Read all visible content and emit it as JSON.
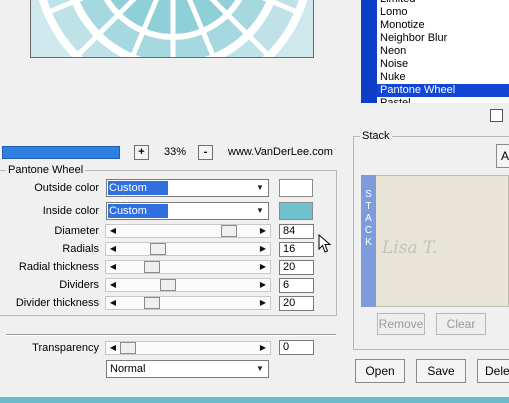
{
  "preview": {
    "accent": "#cfe8ee"
  },
  "zoom": {
    "plus": "+",
    "value": "33%",
    "minus": "-",
    "site": "www.VanDerLee.com"
  },
  "effect_group": {
    "title": "Pantone Wheel",
    "outside_color": {
      "label": "Outside color",
      "value": "Custom >>>",
      "swatch": "#ffffff"
    },
    "inside_color": {
      "label": "Inside color",
      "value": "Custom >>>",
      "swatch": "#6ec1cd"
    },
    "sliders": [
      {
        "label": "Diameter",
        "value": "84",
        "level": 0.84
      },
      {
        "label": "Radials",
        "value": "16",
        "level": 0.25
      },
      {
        "label": "Radial thickness",
        "value": "20",
        "level": 0.2
      },
      {
        "label": "Dividers",
        "value": "6",
        "level": 0.33
      },
      {
        "label": "Divider thickness",
        "value": "20",
        "level": 0.2
      }
    ]
  },
  "transparency": {
    "label": "Transparency",
    "value": "0",
    "level": 0
  },
  "blend_mode": {
    "value": "Normal"
  },
  "effects_list": {
    "items": [
      "Limited",
      "Lomo",
      "Monotize",
      "Neighbor Blur",
      "Neon",
      "Noise",
      "Nuke",
      "Pantone Wheel",
      "Pastel"
    ],
    "selected": "Pantone Wheel"
  },
  "stack": {
    "title": "Stack",
    "add_label": "A",
    "strip_letters": [
      "S",
      "T",
      "A",
      "C",
      "K"
    ],
    "remove_label": "Remove",
    "clear_label": "Clear",
    "watermark": "Lisa T."
  },
  "footer": {
    "open": "Open",
    "save": "Save",
    "delete": "Dele"
  }
}
